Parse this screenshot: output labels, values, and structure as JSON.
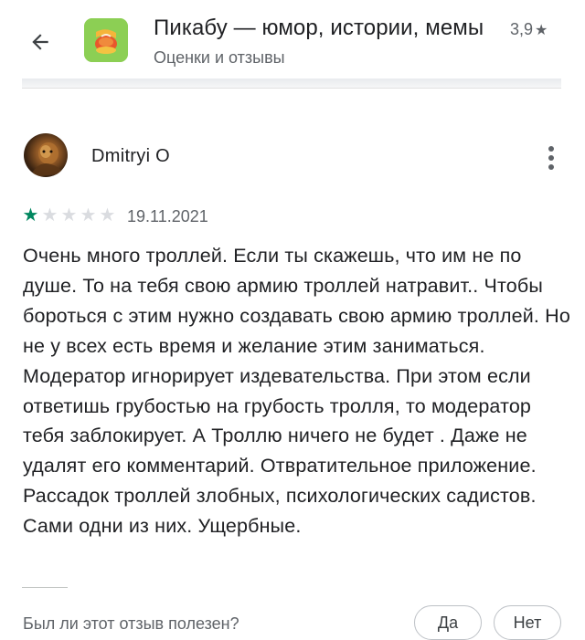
{
  "header": {
    "back_icon": "arrow-back-icon",
    "app_icon": "pikabu-app-icon",
    "app_title": "Пикабу — юмор, истории, мемы",
    "app_rating": "3,9",
    "rating_star_glyph": "★",
    "subtitle": "Оценки и отзывы"
  },
  "review": {
    "author": "Dmitryi O",
    "avatar_icon": "user-avatar",
    "more_icon": "more-vert-icon",
    "rating": 1,
    "rating_max": 5,
    "date": "19.11.2021",
    "text": "Очень много троллей. Если ты скажешь, что им не по душе. То на тебя свою армию троллей натравит.. Чтобы бороться с этим нужно создавать свою армию троллей. Но не у всех есть время и желание этим заниматься. Модератор игнорирует издевательства. При этом если ответишь грубостью на грубость тролля, то модератор тебя заблокирует. А Троллю ничего не будет . Даже не удалят его комментарий. Отвратительное приложение. Рассадок троллей злобных, психологических садистов. Сами одни из них. Ущербные."
  },
  "helpful": {
    "question": "Был ли этот отзыв полезен?",
    "yes_label": "Да",
    "no_label": "Нет"
  },
  "colors": {
    "star_filled": "#01875f",
    "star_empty": "#dadce0",
    "app_icon_bg": "#8ccf54"
  }
}
